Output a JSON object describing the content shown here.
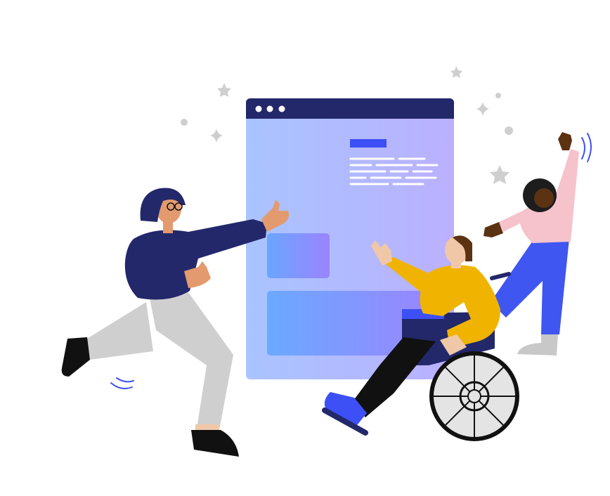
{
  "colors": {
    "background": "#ffffff",
    "navy": "#23286b",
    "window_grad_start": "#a9c4ff",
    "window_grad_end": "#b9b0ff",
    "window_titlebar": "#23286b",
    "accent_blue": "#3d50f5",
    "card_grad_start": "#6fa2ff",
    "card_grad_end": "#9a86ff",
    "skin_light": "#e39a6e",
    "skin_medium": "#f0c8a8",
    "skin_dark": "#5b3212",
    "pants_gray": "#cfcfcf",
    "shoe_black": "#111111",
    "sweater_yellow": "#f0b400",
    "pink_top": "#f6c2cc",
    "blue_pants": "#3f56f0",
    "wheel_gray": "#e4e4e4",
    "sparkle_gray": "#cccccc",
    "hair_dark": "#1d1d1d"
  },
  "icons": {
    "window_dots": "browser-window-dots-icon",
    "sparkles": "sparkle-star-icon"
  }
}
